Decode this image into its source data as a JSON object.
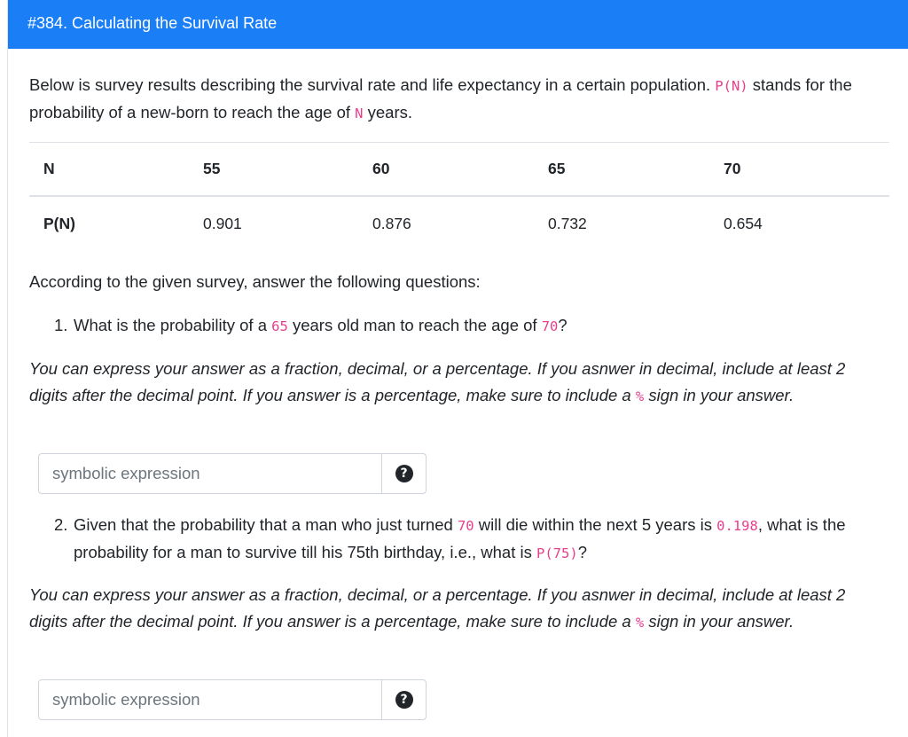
{
  "header": {
    "title": "#384. Calculating the Survival Rate"
  },
  "intro": {
    "text1": "Below is survey results describing the survival rate and life expectancy in a certain population. ",
    "code1": "P(N)",
    "text2": " stands for the probability of a new-born to reach the age of ",
    "code2": "N",
    "text3": " years."
  },
  "table": {
    "headers": [
      "N",
      "55",
      "60",
      "65",
      "70"
    ],
    "row": [
      "P(N)",
      "0.901",
      "0.876",
      "0.732",
      "0.654"
    ]
  },
  "according": "According to the given survey, answer the following questions:",
  "q1": {
    "num": "1.",
    "t1": "What is the probability of a ",
    "c1": "65",
    "t2": " years old man to reach the age of ",
    "c2": "70",
    "t3": "?"
  },
  "hint": {
    "t1": "You can express your answer as a fraction, decimal, or a percentage. If you asnwer in decimal, include at least 2 digits after the decimal point. If you answer is a percentage, make sure to include a ",
    "c1": "%",
    "t2": " sign in your answer."
  },
  "input": {
    "placeholder": "symbolic expression",
    "help_icon": "question-circle-icon"
  },
  "q2": {
    "num": "2.",
    "t1": "Given that the probability that a man who just turned ",
    "c1": "70",
    "t2": " will die within the next 5 years is ",
    "c2": "0.198",
    "t3": ", what is the probability for a man to survive till his 75th birthday, i.e., what is ",
    "c3": "P(75)",
    "t4": "?"
  }
}
